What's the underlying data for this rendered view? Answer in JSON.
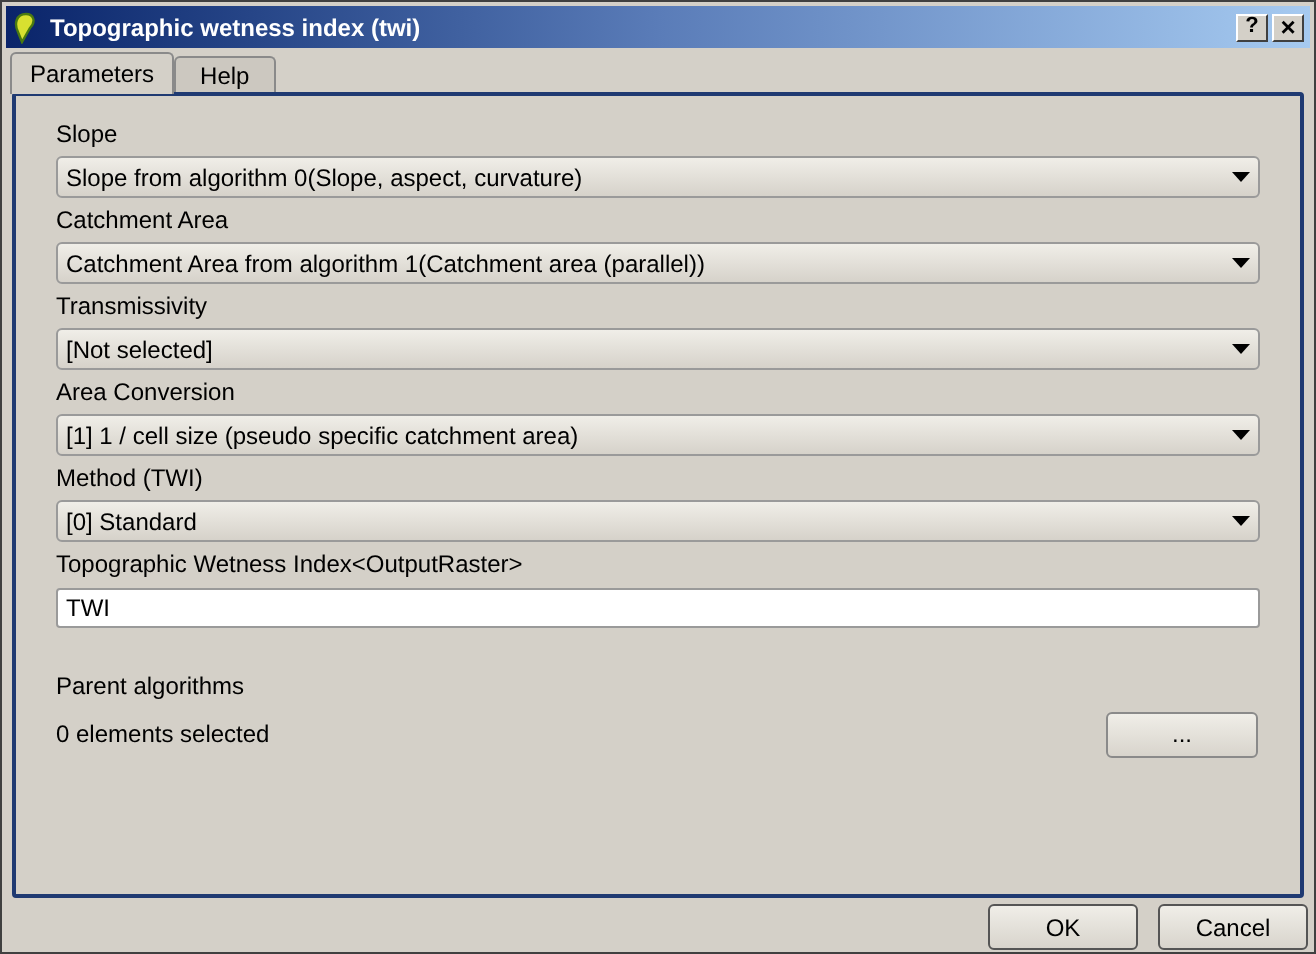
{
  "window": {
    "title": "Topographic wetness index (twi)",
    "help_button": "?",
    "close_button": "×"
  },
  "tabs": [
    {
      "label": "Parameters",
      "selected": true
    },
    {
      "label": "Help",
      "selected": false
    }
  ],
  "fields": [
    {
      "kind": "combo",
      "label": "Slope",
      "value": "Slope from algorithm 0(Slope, aspect, curvature)"
    },
    {
      "kind": "combo",
      "label": "Catchment Area",
      "value": "Catchment Area from algorithm 1(Catchment area (parallel))"
    },
    {
      "kind": "combo",
      "label": "Transmissivity",
      "value": "[Not selected]"
    },
    {
      "kind": "combo",
      "label": "Area Conversion",
      "value": "[1] 1 / cell size (pseudo specific catchment area)"
    },
    {
      "kind": "combo",
      "label": "Method (TWI)",
      "value": "[0] Standard"
    },
    {
      "kind": "text",
      "label": "Topographic Wetness Index<OutputRaster>",
      "value": "TWI"
    }
  ],
  "parent_algorithms": {
    "label": "Parent algorithms",
    "status": "0 elements selected",
    "button": "..."
  },
  "buttons": [
    "OK",
    "Cancel"
  ]
}
